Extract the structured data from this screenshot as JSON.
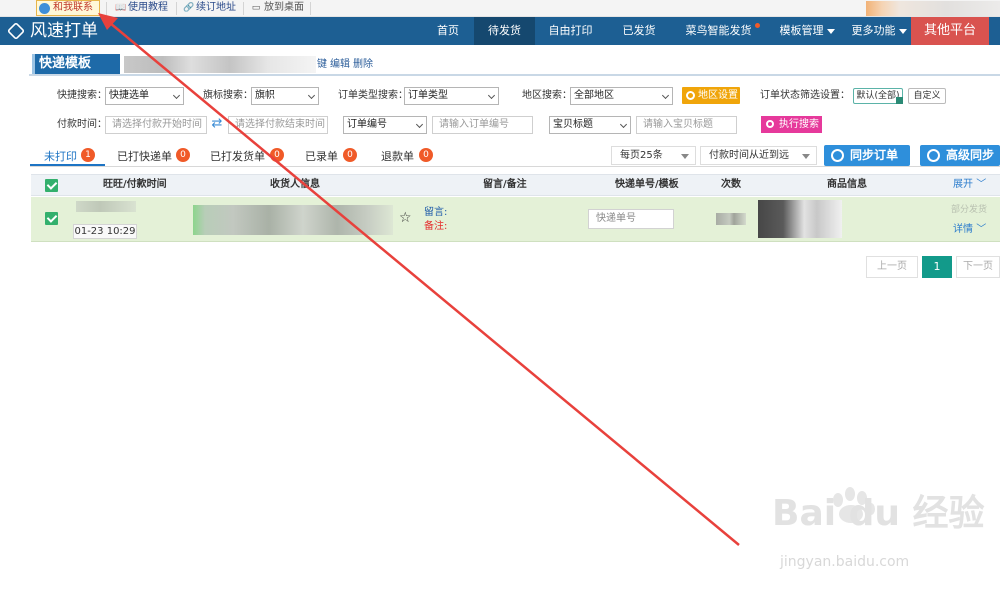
{
  "topbar": {
    "contact": "和我联系",
    "tutorial": "使用教程",
    "renew": "续订地址",
    "desktop": "放到桌面"
  },
  "nav": {
    "logo": "风速打单",
    "items": [
      {
        "label": "首页"
      },
      {
        "label": "待发货"
      },
      {
        "label": "自由打印"
      },
      {
        "label": "已发货"
      },
      {
        "label": "菜鸟智能发货"
      },
      {
        "label": "模板管理"
      },
      {
        "label": "更多功能"
      }
    ],
    "other_platform": "其他平台"
  },
  "template": {
    "label": "快递模板",
    "links": [
      "键",
      "编辑",
      "删除"
    ]
  },
  "search": {
    "quick_label": "快捷搜索：",
    "quick_value": "快捷选单",
    "flag_label": "旗标搜索：",
    "flag_value": "旗帜",
    "type_label": "订单类型搜索：",
    "type_value": "订单类型",
    "region_label": "地区搜索：",
    "region_value": "全部地区",
    "region_btn": "地区设置",
    "status_label": "订单状态筛选设置：",
    "default_btn": "默认(全部)",
    "custom_btn": "自定义",
    "pay_time_label": "付款时间：",
    "pay_start_placeholder": "请选择付款开始时间",
    "pay_end_placeholder": "请选择付款结束时间",
    "order_no_select": "订单编号",
    "order_no_placeholder": "请输入订单编号",
    "item_select": "宝贝标题",
    "item_placeholder": "请输入宝贝标题",
    "exec_btn": "执行搜索"
  },
  "tabs": [
    {
      "label": "未打印",
      "count": "1"
    },
    {
      "label": "已打快递单",
      "count": "0"
    },
    {
      "label": "已打发货单",
      "count": "0"
    },
    {
      "label": "已录单",
      "count": "0"
    },
    {
      "label": "退款单",
      "count": "0"
    }
  ],
  "toolbar": {
    "per_page": "每页25条",
    "sort": "付款时间从近到远",
    "sync_btn": "同步订单",
    "adv_sync_btn": "高级同步"
  },
  "table": {
    "headers": [
      "旺旺/付款时间",
      "收货人信息",
      "留言/备注",
      "快递单号/模板",
      "次数",
      "商品信息"
    ],
    "expand": "展开",
    "row": {
      "date": "01-23 10:29",
      "message_label": "留言:",
      "note_label": "备注:",
      "express_placeholder": "快递单号",
      "partial_ship": "部分发货",
      "detail": "详情"
    }
  },
  "pagination": {
    "prev": "上一页",
    "current": "1",
    "next": "下一页"
  },
  "watermark": {
    "brand": "Bai du 经验",
    "url": "jingyan.baidu.com"
  },
  "colors": {
    "nav_bg": "#1d5f93",
    "active_tab": "#1d74c4",
    "badge": "#f05a28",
    "row_bg": "#e4f1d7",
    "arrow": "#e8413c"
  }
}
